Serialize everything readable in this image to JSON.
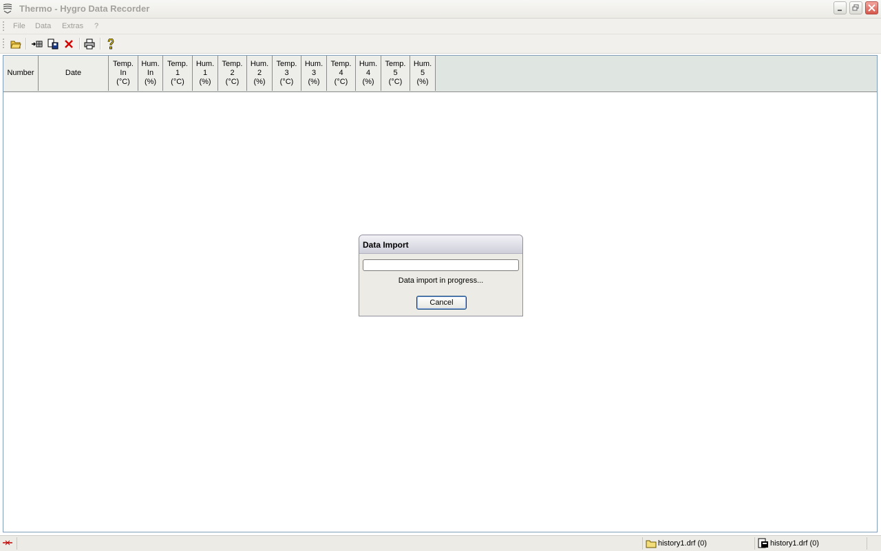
{
  "window": {
    "title": "Thermo - Hygro  Data Recorder"
  },
  "menu": [
    "File",
    "Data",
    "Extras",
    "?"
  ],
  "toolbar": [
    {
      "name": "open-folder-icon"
    },
    {
      "name": "import-data-icon"
    },
    {
      "name": "save-data-icon"
    },
    {
      "name": "delete-icon"
    },
    {
      "name": "print-icon"
    },
    {
      "name": "help-icon"
    }
  ],
  "table": {
    "columns": [
      "Number",
      "Date",
      "Temp.\nIn\n(°C)",
      "Hum.\nIn\n(%)",
      "Temp.\n1\n(°C)",
      "Hum.\n1\n(%)",
      "Temp.\n2\n(°C)",
      "Hum.\n2\n(%)",
      "Temp.\n3\n(°C)",
      "Hum.\n3\n(%)",
      "Temp.\n4\n(°C)",
      "Hum.\n4\n(%)",
      "Temp.\n5\n(°C)",
      "Hum.\n5\n(%)"
    ],
    "rows": []
  },
  "dialog": {
    "title": "Data Import",
    "message": "Data import in progress...",
    "progress": 0,
    "cancel_label": "Cancel"
  },
  "status": {
    "panel1": "history1.drf (0)",
    "panel2": "history1.drf (0)"
  },
  "colors": {
    "grid_border": "#7f9db9",
    "delete_red": "#d40000",
    "progress_green": "#3cbf3c"
  }
}
